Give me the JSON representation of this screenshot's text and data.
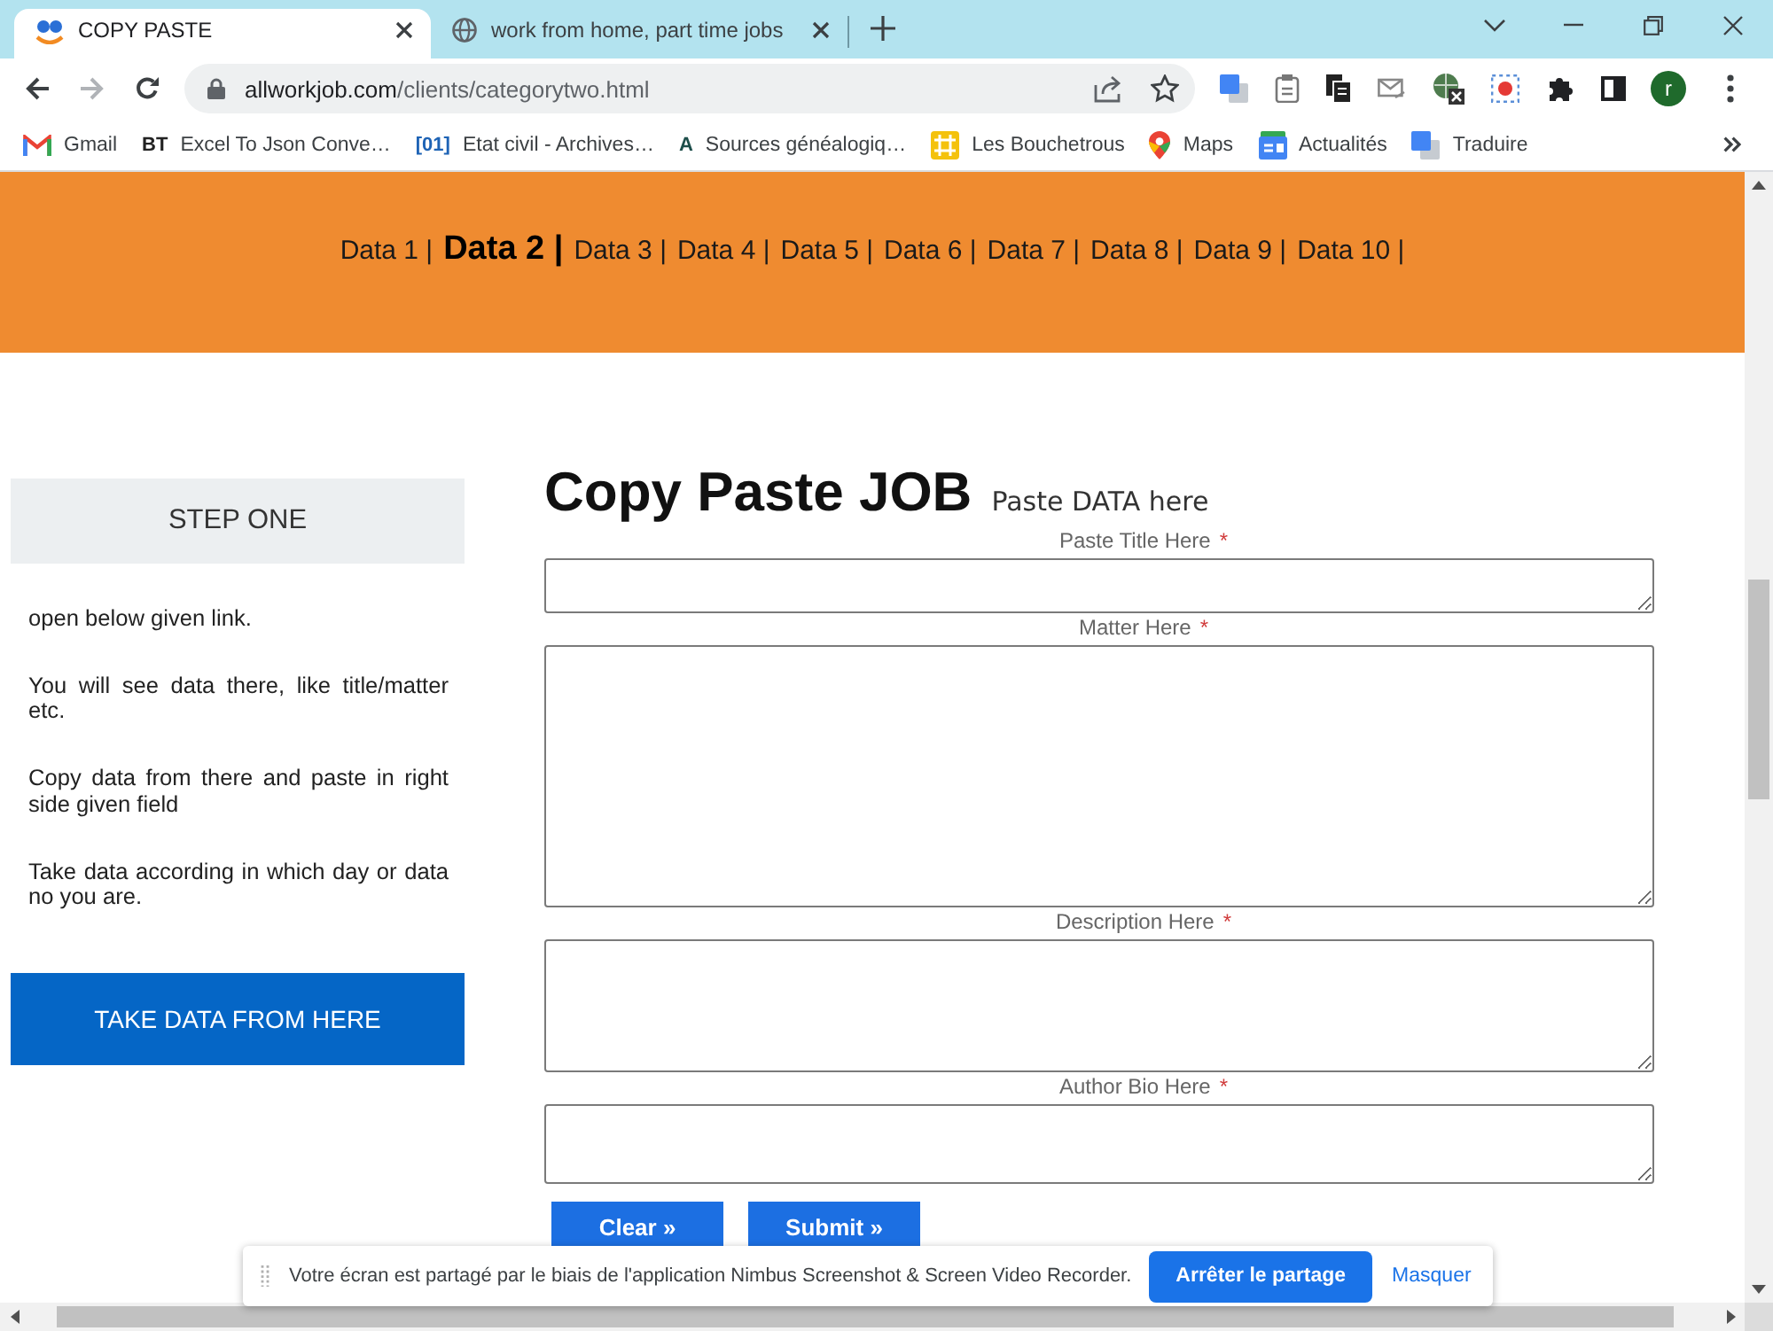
{
  "browser": {
    "tabs": [
      {
        "title": "COPY PASTE",
        "kind": "site",
        "selected": true
      },
      {
        "title": "work from home, part time jobs",
        "kind": "web",
        "selected": false
      }
    ],
    "navigation": [
      {
        "kind": "back",
        "disabled": false
      },
      {
        "kind": "forward",
        "disabled": true
      },
      {
        "kind": "reload",
        "disabled": false
      }
    ],
    "address": {
      "host": "allworkjob.com",
      "path": "/clients/categorytwo.html"
    },
    "profile": {
      "initial": "r"
    },
    "bookmarks": [
      {
        "label": "Gmail",
        "kind": "mail"
      },
      {
        "label": "Excel To Json Conve…",
        "kind": "letters",
        "badge": "BT",
        "color": "#222222"
      },
      {
        "label": "Etat civil - Archives…",
        "kind": "letters",
        "badge": "[01]",
        "color": "#1e63b5"
      },
      {
        "label": "Sources généalogiq…",
        "kind": "letters",
        "badge": "A",
        "color": "#1d4e4a"
      },
      {
        "label": "Les Bouchetrous",
        "kind": "tile"
      },
      {
        "label": "Maps",
        "kind": "map"
      },
      {
        "label": "Actualités",
        "kind": "news"
      },
      {
        "label": "Traduire",
        "kind": "translate"
      }
    ]
  },
  "site_nav": [
    {
      "label": "Data 1 |",
      "selected": false
    },
    {
      "label": "Data 2 |",
      "selected": true
    },
    {
      "label": "Data 3 |",
      "selected": false
    },
    {
      "label": "Data 4 |",
      "selected": false
    },
    {
      "label": "Data 5 |",
      "selected": false
    },
    {
      "label": "Data 6 |",
      "selected": false
    },
    {
      "label": "Data 7 |",
      "selected": false
    },
    {
      "label": "Data 8 |",
      "selected": false
    },
    {
      "label": "Data 9 |",
      "selected": false
    },
    {
      "label": "Data 10 |",
      "selected": false
    }
  ],
  "step_panel": {
    "heading": "STEP ONE",
    "paragraphs": [
      "open below given link.",
      "You will see data there, like title/matter etc.",
      "Copy data from there and paste in right side given field",
      "Take data according in which day or data no you are."
    ],
    "button": "TAKE DATA FROM HERE"
  },
  "form": {
    "title": "Copy Paste JOB",
    "subtitle": "Paste DATA here",
    "fields": [
      {
        "label": "Paste Title Here",
        "marker": "*"
      },
      {
        "label": "Matter Here",
        "marker": "*"
      },
      {
        "label": "Description Here",
        "marker": "*"
      },
      {
        "label": "Author Bio Here",
        "marker": "*"
      }
    ],
    "buttons": [
      "Clear »",
      "Submit »"
    ]
  },
  "share_bar": {
    "message": "Votre écran est partagé par le biais de l'application Nimbus Screenshot & Screen Video Recorder.",
    "stop_button": "Arrêter le partage",
    "hide_link": "Masquer"
  }
}
